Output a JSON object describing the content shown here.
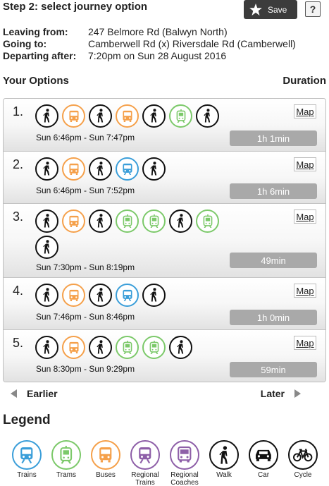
{
  "header": {
    "title": "Step 2: select journey option",
    "save_label": "Save",
    "help_label": "?"
  },
  "journey": {
    "leaving_label": "Leaving from:",
    "leaving_value": "247 Belmore Rd (Balwyn North)",
    "going_label": "Going to:",
    "going_value": "Camberwell Rd (x) Riversdale Rd (Camberwell)",
    "departing_label": "Departing after:",
    "departing_value": "7:20pm on Sun 28 August 2016"
  },
  "options_header": {
    "title": "Your Options",
    "duration": "Duration"
  },
  "options": [
    {
      "num": "1.",
      "times": "Sun 6:46pm - Sun 7:47pm",
      "duration": "1h 1min",
      "map": "Map",
      "legs": [
        "walk",
        "bus",
        "walk",
        "bus",
        "walk",
        "tram",
        "walk"
      ]
    },
    {
      "num": "2.",
      "times": "Sun 6:46pm - Sun 7:52pm",
      "duration": "1h 6min",
      "map": "Map",
      "legs": [
        "walk",
        "bus",
        "walk",
        "train",
        "walk"
      ]
    },
    {
      "num": "3.",
      "times": "Sun 7:30pm - Sun 8:19pm",
      "duration": "49min",
      "map": "Map",
      "legs": [
        "walk",
        "bus",
        "walk",
        "tram",
        "tram",
        "walk",
        "tram",
        "walk"
      ]
    },
    {
      "num": "4.",
      "times": "Sun 7:46pm - Sun 8:46pm",
      "duration": "1h 0min",
      "map": "Map",
      "legs": [
        "walk",
        "bus",
        "walk",
        "train",
        "walk"
      ]
    },
    {
      "num": "5.",
      "times": "Sun 8:30pm - Sun 9:29pm",
      "duration": "59min",
      "map": "Map",
      "legs": [
        "walk",
        "bus",
        "walk",
        "tram",
        "tram",
        "walk"
      ]
    }
  ],
  "pager": {
    "earlier": "Earlier",
    "later": "Later"
  },
  "legend": {
    "title": "Legend",
    "items": [
      {
        "mode": "train",
        "label": "Trains"
      },
      {
        "mode": "tram",
        "label": "Trams"
      },
      {
        "mode": "bus",
        "label": "Buses"
      },
      {
        "mode": "rtrain",
        "label": "Regional Trains"
      },
      {
        "mode": "rcoach",
        "label": "Regional Coaches"
      },
      {
        "mode": "walk",
        "label": "Walk"
      },
      {
        "mode": "car",
        "label": "Car"
      },
      {
        "mode": "cycle",
        "label": "Cycle"
      }
    ]
  },
  "mode_colors": {
    "walk": "#111111",
    "bus": "#f5a04a",
    "tram": "#7cc96a",
    "train": "#3a9ed9",
    "rtrain": "#8e5fa8",
    "rcoach": "#8e5fa8",
    "car": "#111111",
    "cycle": "#111111"
  },
  "mode_icons": {
    "walk": "walk-icon",
    "bus": "bus-icon",
    "tram": "tram-icon",
    "train": "train-icon",
    "rtrain": "regional-train-icon",
    "rcoach": "regional-coach-icon",
    "car": "car-icon",
    "cycle": "cycle-icon"
  }
}
